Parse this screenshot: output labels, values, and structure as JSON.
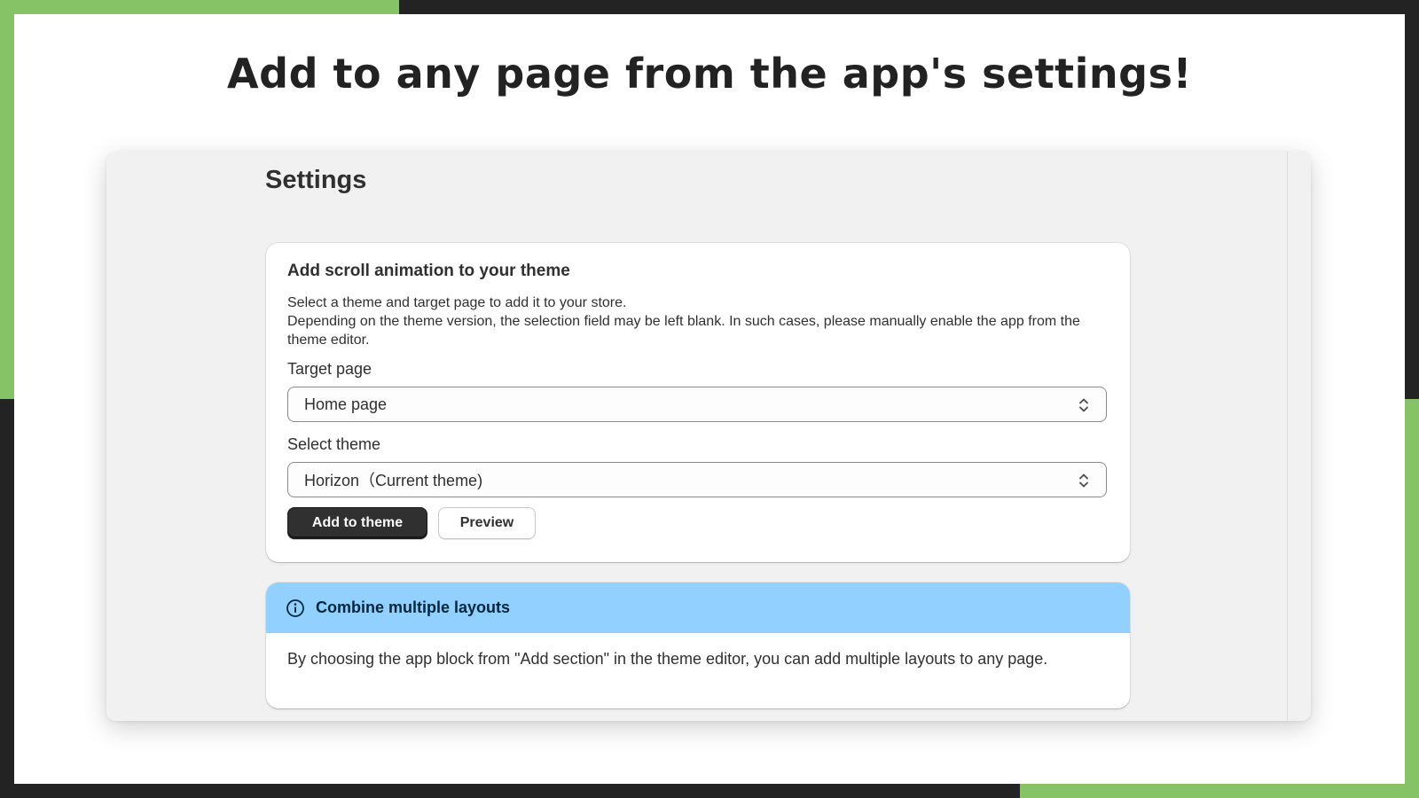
{
  "slide": {
    "headline": "Add to any page from the app's settings!"
  },
  "settings": {
    "title": "Settings",
    "card": {
      "title": "Add scroll animation to your theme",
      "description_lines": [
        "Select a theme and target page to add it to your store.",
        "Depending on the theme version, the selection field may be left blank. In such cases, please manually enable the app from the theme editor."
      ],
      "target_page": {
        "label": "Target page",
        "value": "Home page"
      },
      "select_theme": {
        "label": "Select theme",
        "value": "Horizon（Current theme)"
      },
      "add_button_label": "Add to theme",
      "preview_button_label": "Preview"
    },
    "banner": {
      "icon": "info-icon",
      "title": "Combine multiple layouts",
      "body": "By choosing the app block from \"Add section\" in the theme editor, you can add multiple layouts to any page."
    }
  },
  "colors": {
    "accent_green": "#86c266",
    "frame_dark": "#232323",
    "banner_blue": "#91d0ff",
    "primary_button": "#303030"
  }
}
